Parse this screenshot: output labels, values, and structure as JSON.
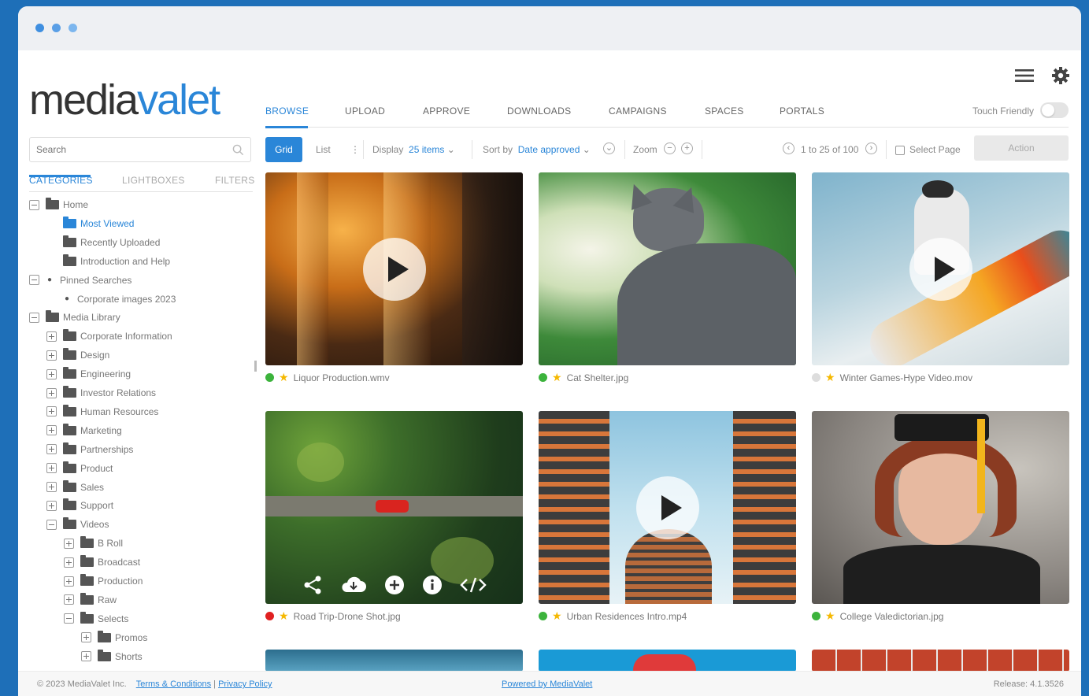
{
  "brand": {
    "logo_part1": "media",
    "logo_part2": "valet",
    "accent": "#2a86d8"
  },
  "nav": {
    "tabs": [
      "BROWSE",
      "UPLOAD",
      "APPROVE",
      "DOWNLOADS",
      "CAMPAIGNS",
      "SPACES",
      "PORTALS"
    ],
    "active": "BROWSE",
    "touch_friendly_label": "Touch Friendly"
  },
  "sidebar": {
    "search_placeholder": "Search",
    "tabs": [
      "CATEGORIES",
      "LIGHTBOXES",
      "FILTERS"
    ],
    "tree": [
      {
        "label": "Home",
        "level": 0,
        "toggle": "minus",
        "icon": "folder"
      },
      {
        "label": "Most Viewed",
        "level": 1,
        "toggle": "none",
        "icon": "folder-open",
        "active": true
      },
      {
        "label": "Recently Uploaded",
        "level": 1,
        "toggle": "none",
        "icon": "folder"
      },
      {
        "label": "Introduction and Help",
        "level": 1,
        "toggle": "none",
        "icon": "folder"
      },
      {
        "label": "Pinned Searches",
        "level": 0,
        "toggle": "minus",
        "icon": "pin"
      },
      {
        "label": "Corporate images 2023",
        "level": 1,
        "toggle": "none",
        "icon": "pin"
      },
      {
        "label": "Media Library",
        "level": 0,
        "toggle": "minus",
        "icon": "folder"
      },
      {
        "label": "Corporate Information",
        "level": 1,
        "toggle": "plus",
        "icon": "folder"
      },
      {
        "label": "Design",
        "level": 1,
        "toggle": "plus",
        "icon": "folder"
      },
      {
        "label": "Engineering",
        "level": 1,
        "toggle": "plus",
        "icon": "folder"
      },
      {
        "label": "Investor Relations",
        "level": 1,
        "toggle": "plus",
        "icon": "folder"
      },
      {
        "label": "Human Resources",
        "level": 1,
        "toggle": "plus",
        "icon": "folder"
      },
      {
        "label": "Marketing",
        "level": 1,
        "toggle": "plus",
        "icon": "folder"
      },
      {
        "label": "Partnerships",
        "level": 1,
        "toggle": "plus",
        "icon": "folder"
      },
      {
        "label": "Product",
        "level": 1,
        "toggle": "plus",
        "icon": "folder"
      },
      {
        "label": "Sales",
        "level": 1,
        "toggle": "plus",
        "icon": "folder"
      },
      {
        "label": "Support",
        "level": 1,
        "toggle": "plus",
        "icon": "folder"
      },
      {
        "label": "Videos",
        "level": 1,
        "toggle": "minus",
        "icon": "folder"
      },
      {
        "label": "B Roll",
        "level": 2,
        "toggle": "plus",
        "icon": "folder"
      },
      {
        "label": "Broadcast",
        "level": 2,
        "toggle": "plus",
        "icon": "folder"
      },
      {
        "label": "Production",
        "level": 2,
        "toggle": "plus",
        "icon": "folder"
      },
      {
        "label": "Raw",
        "level": 2,
        "toggle": "plus",
        "icon": "folder"
      },
      {
        "label": "Selects",
        "level": 2,
        "toggle": "minus",
        "icon": "folder"
      },
      {
        "label": "Promos",
        "level": 3,
        "toggle": "plus",
        "icon": "folder"
      },
      {
        "label": "Shorts",
        "level": 3,
        "toggle": "plus",
        "icon": "folder"
      }
    ]
  },
  "toolbar": {
    "grid_label": "Grid",
    "list_label": "List",
    "display_label": "Display",
    "display_value": "25 items",
    "sort_label": "Sort by",
    "sort_value": "Date approved",
    "zoom_label": "Zoom",
    "pagination": "1 to 25 of 100",
    "select_page_label": "Select Page",
    "action_label": "Action"
  },
  "assets": [
    {
      "name": "Liquor Production.wmv",
      "status_color": "#3cb33c",
      "video": true
    },
    {
      "name": "Cat Shelter.jpg",
      "status_color": "#3cb33c",
      "video": false
    },
    {
      "name": "Winter Games-Hype Video.mov",
      "status_color": "#dddddd",
      "video": true
    },
    {
      "name": "Road Trip-Drone Shot.jpg",
      "status_color": "#e02020",
      "video": false
    },
    {
      "name": "Urban Residences Intro.mp4",
      "status_color": "#3cb33c",
      "video": true
    },
    {
      "name": "College Valedictorian.jpg",
      "status_color": "#3cb33c",
      "video": false
    }
  ],
  "footer": {
    "copyright": "© 2023 MediaValet Inc.",
    "terms": "Terms & Conditions",
    "divider": "|",
    "privacy": "Privacy Policy",
    "powered": "Powered by MediaValet",
    "release": "Release: 4.1.3526"
  }
}
